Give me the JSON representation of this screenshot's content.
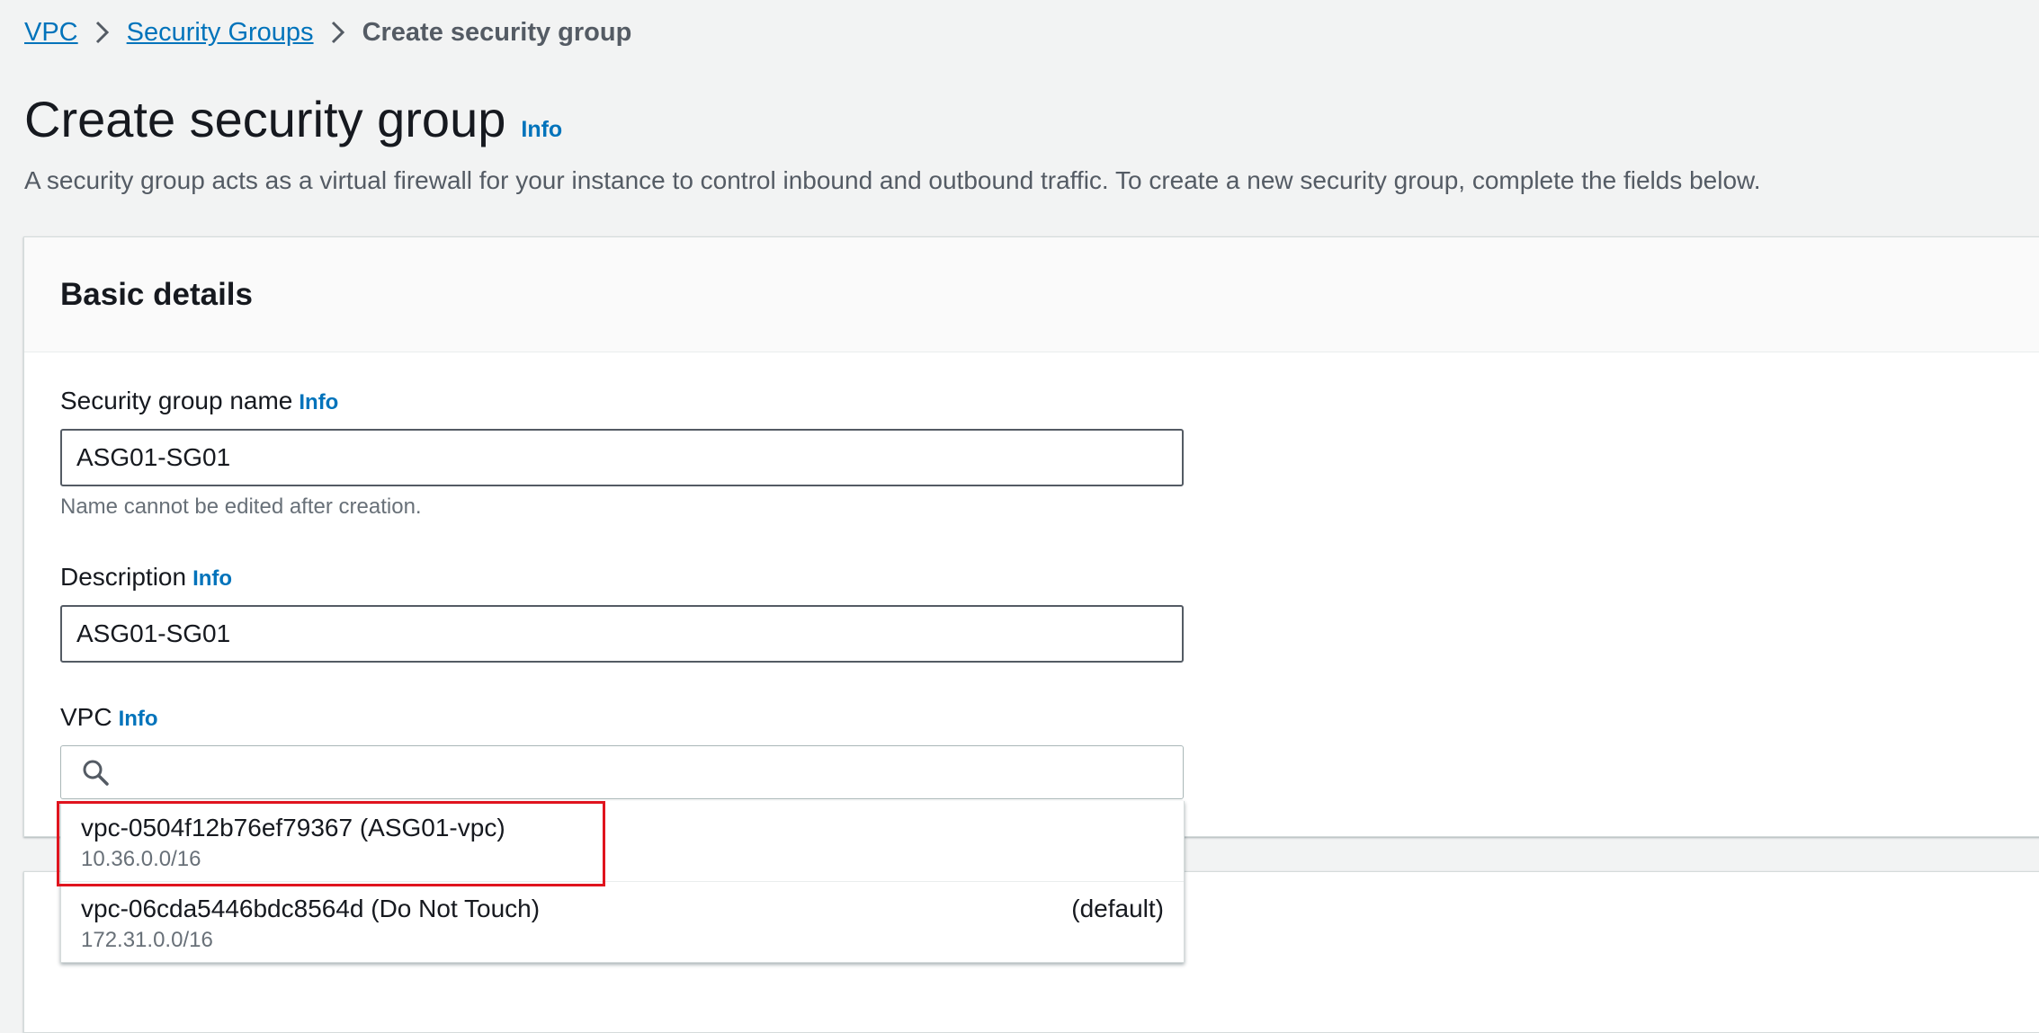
{
  "breadcrumb": {
    "items": [
      {
        "label": "VPC"
      },
      {
        "label": "Security Groups"
      }
    ],
    "current": "Create security group"
  },
  "page": {
    "title": "Create security group",
    "info_label": "Info",
    "description": "A security group acts as a virtual firewall for your instance to control inbound and outbound traffic. To create a new security group, complete the fields below."
  },
  "basic_details": {
    "heading": "Basic details",
    "name_field": {
      "label": "Security group name",
      "info_label": "Info",
      "value": "ASG01-SG01",
      "hint": "Name cannot be edited after creation."
    },
    "description_field": {
      "label": "Description",
      "info_label": "Info",
      "value": "ASG01-SG01"
    },
    "vpc_field": {
      "label": "VPC",
      "info_label": "Info",
      "search_value": ""
    }
  },
  "vpc_dropdown": {
    "options": [
      {
        "title": "vpc-0504f12b76ef79367 (ASG01-vpc)",
        "cidr": "10.36.0.0/16",
        "tag": ""
      },
      {
        "title": "vpc-06cda5446bdc8564d (Do Not Touch)",
        "cidr": "172.31.0.0/16",
        "tag": "(default)"
      }
    ],
    "highlighted_index": 0
  },
  "colors": {
    "link": "#0073bb",
    "highlight_border": "#e0141e",
    "background": "#f2f3f3"
  },
  "icons": {
    "breadcrumb_separator": "chevron-right-icon",
    "search": "search-icon"
  }
}
